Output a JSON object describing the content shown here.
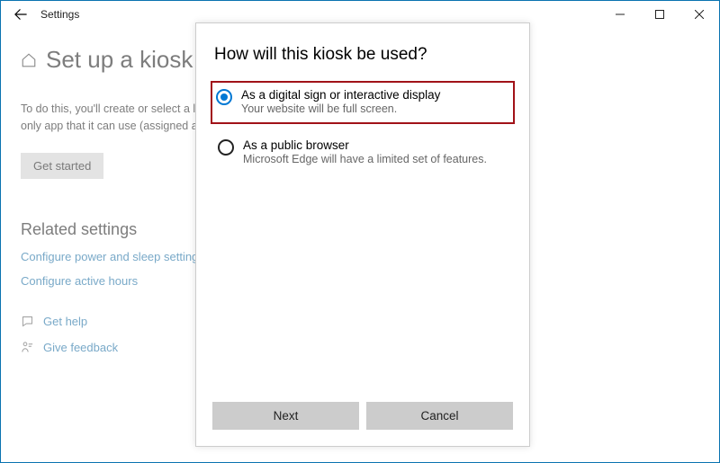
{
  "window": {
    "title": "Settings"
  },
  "page": {
    "heading": "Set up a kiosk",
    "description_line1": "To do this, you'll create or select a loc",
    "description_line2": "only app that it can use (assigned acc",
    "get_started_label": "Get started",
    "related_heading": "Related settings",
    "link_power": "Configure power and sleep settings",
    "link_hours": "Configure active hours",
    "help_label": "Get help",
    "feedback_label": "Give feedback"
  },
  "dialog": {
    "title": "How will this kiosk be used?",
    "options": [
      {
        "title": "As a digital sign or interactive display",
        "subtitle": "Your website will be full screen.",
        "selected": true
      },
      {
        "title": "As a public browser",
        "subtitle": "Microsoft Edge will have a limited set of features.",
        "selected": false
      }
    ],
    "next_label": "Next",
    "cancel_label": "Cancel"
  }
}
